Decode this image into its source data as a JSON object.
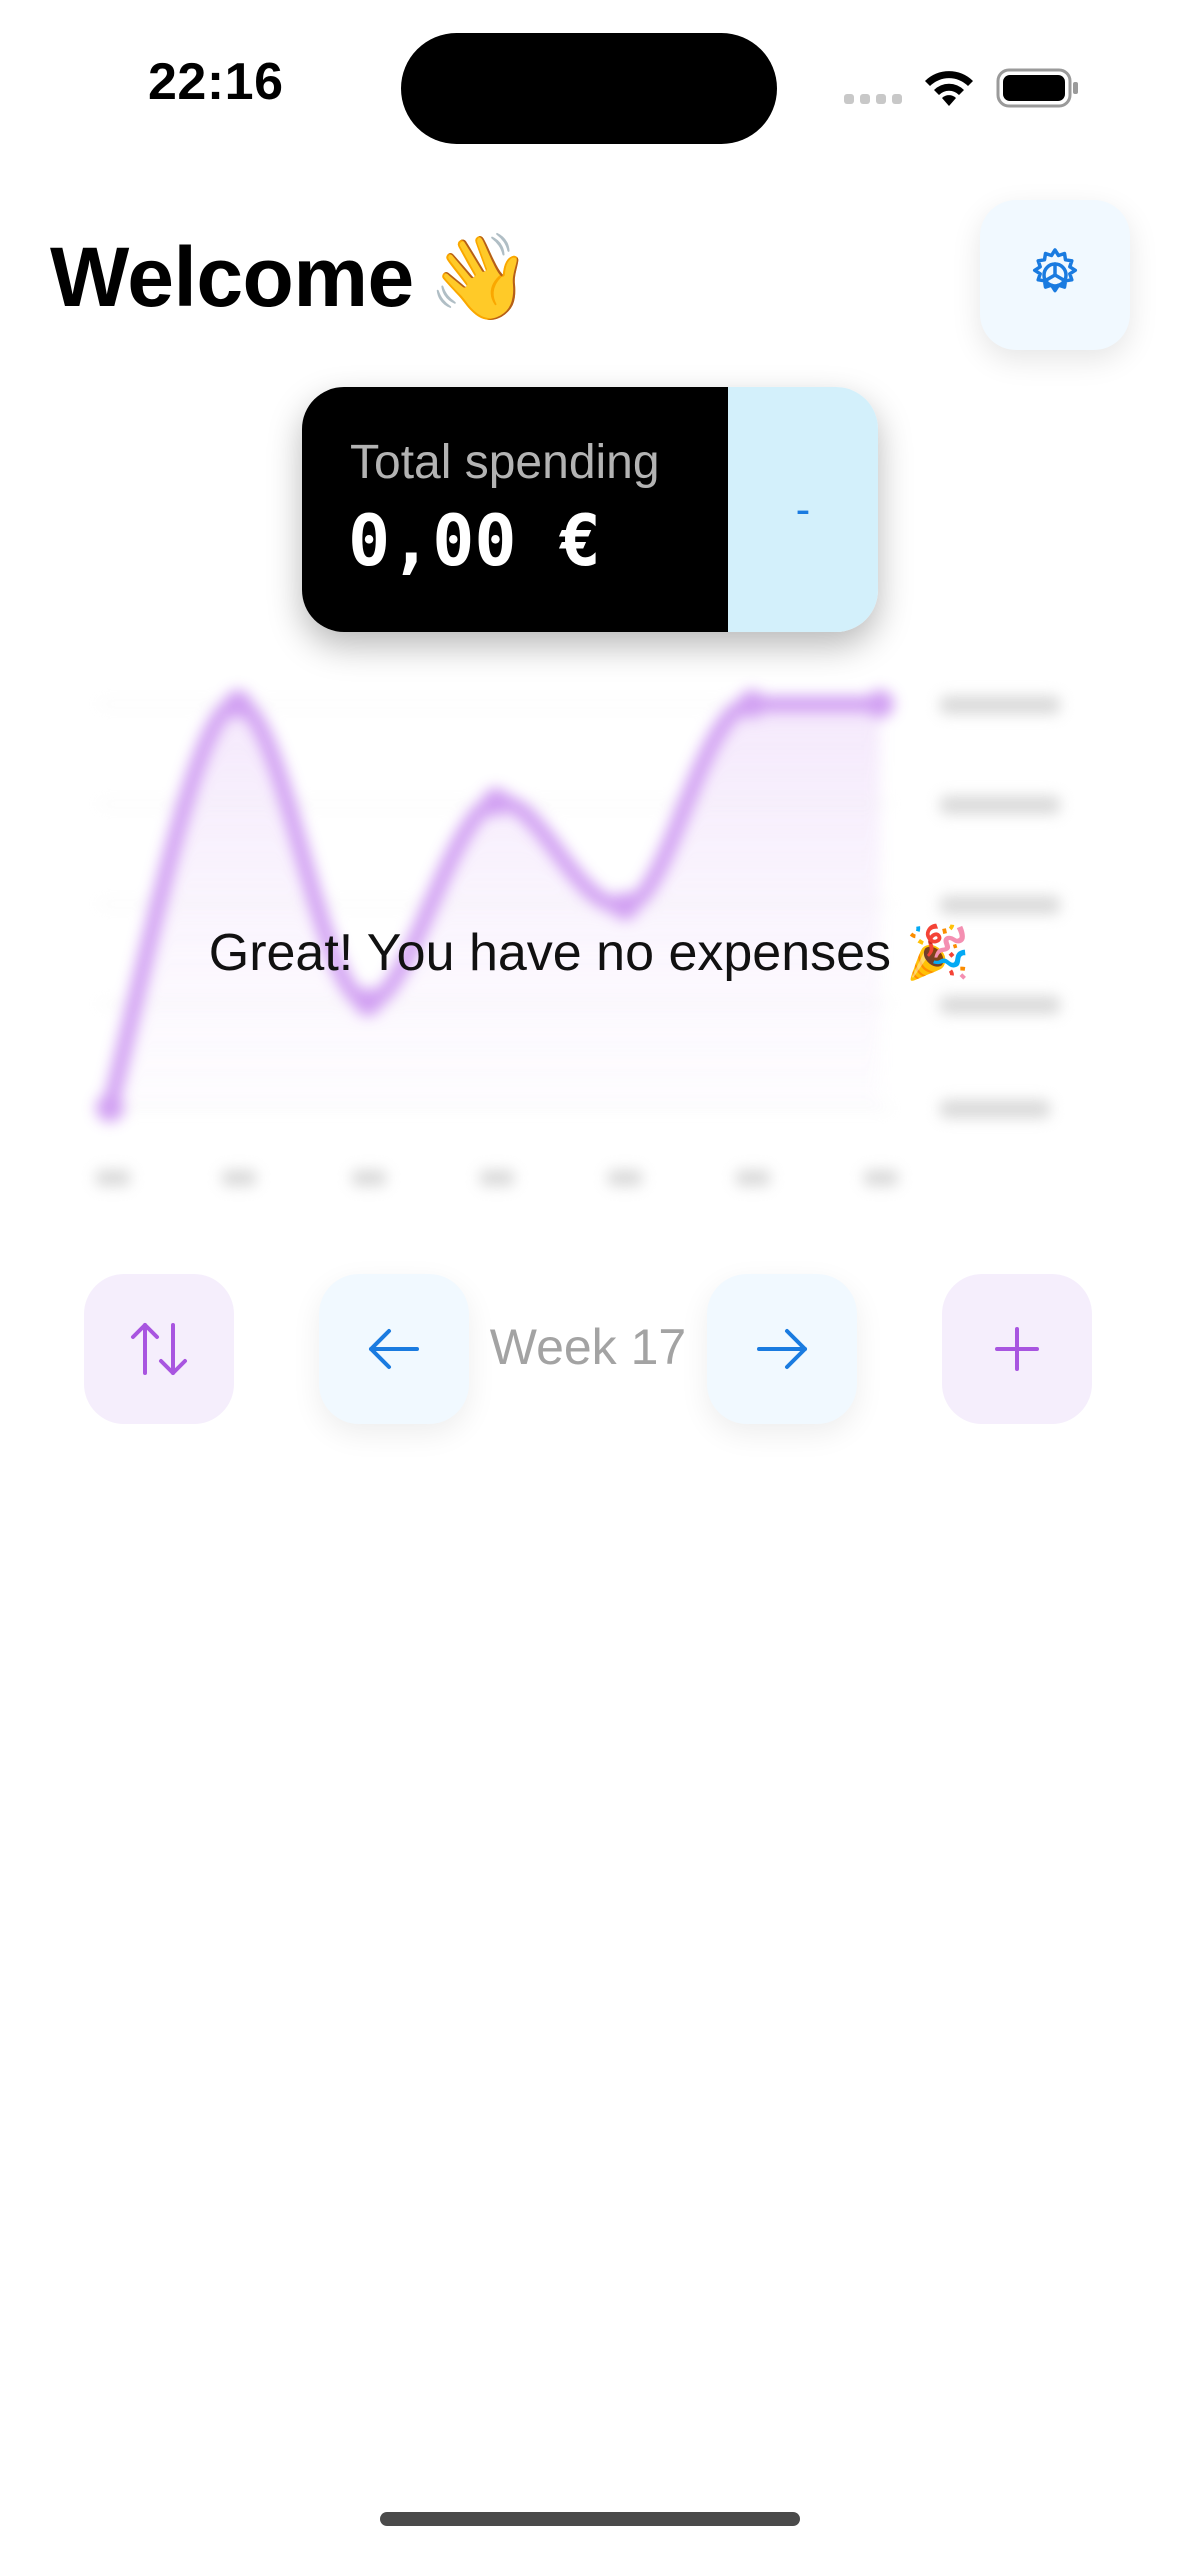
{
  "status_bar": {
    "time": "22:16",
    "icons": [
      "cellular-signal-icon",
      "wifi-icon",
      "battery-icon"
    ]
  },
  "header": {
    "title": "Welcome",
    "emoji": "👋",
    "settings_icon": "gear-icon"
  },
  "summary": {
    "label": "Total spending",
    "value": "0,00 €",
    "badge": "-"
  },
  "empty_state": {
    "message": "Great! You have no expenses 🎉"
  },
  "controls": {
    "sort_icon": "arrows-up-down-icon",
    "prev_icon": "arrow-left-icon",
    "week_label": "Week 17",
    "next_icon": "arrow-right-icon",
    "add_icon": "plus-icon"
  },
  "colors": {
    "accent_blue": "#1a7be0",
    "accent_purple": "#a855e0",
    "chart_line": "#c98ff0",
    "card_black": "#000000",
    "card_badge_bg": "#d3f0fb"
  }
}
